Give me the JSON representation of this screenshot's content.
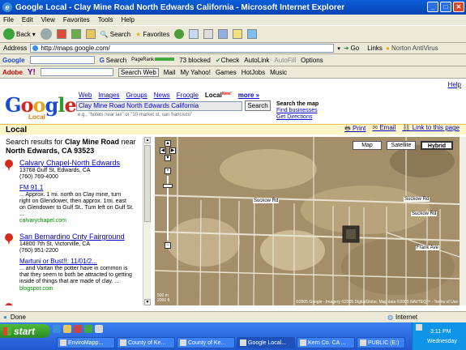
{
  "window": {
    "title": "Google Local - Clay Mine Road North Edwards California - Microsoft Internet Explorer"
  },
  "menu": [
    "File",
    "Edit",
    "View",
    "Favorites",
    "Tools",
    "Help"
  ],
  "toolbar": {
    "back": "Back",
    "search": "Search",
    "favorites": "Favorites"
  },
  "address": {
    "label": "Address",
    "url": "http://maps.google.com/",
    "go": "Go",
    "links": "Links",
    "norton": "Norton AntiVirus"
  },
  "google_toolbar": {
    "label": "Google",
    "search": "Search",
    "pagerank": "PageRank",
    "blocked": "73 blocked",
    "check": "Check",
    "autolink": "AutoLink",
    "autofill": "AutoFill",
    "options": "Options"
  },
  "yahoo_toolbar": {
    "label": "Adobe",
    "yahoo": "Y!",
    "search_web": "Search Web",
    "mail": "Mail",
    "my_yahoo": "My Yahoo!",
    "games": "Games",
    "hotjobs": "HotJobs",
    "music": "Music"
  },
  "page": {
    "help": "Help",
    "logo_sub": "Local",
    "nav": [
      "Web",
      "Images",
      "Groups",
      "News",
      "Froogle"
    ],
    "nav_current": "Local",
    "nav_new": "New!",
    "nav_more": "more »",
    "query": "Clay Mine Road North Edwards California",
    "search_btn": "Search",
    "hint": "e.g., \"hotels near lax\" or \"10 market st, san francisco\"",
    "right_links": {
      "heading": "Search the map",
      "find": "Find businesses",
      "directions": "Get Directions"
    },
    "section": "Local",
    "actions": [
      "Print",
      "Email",
      "Link to this page"
    ]
  },
  "results": {
    "header_prefix": "Search results for ",
    "header_query": "Clay Mine Road",
    "header_near": " near",
    "header_loc": "North Edwards, CA 93523",
    "items": [
      {
        "name": "Calvary Chapel-North Edwards",
        "addr": "13768 Gulf St, Edwards, CA",
        "phone": "(760) 769-4000",
        "sub": "FM 91.1",
        "snip1": "... Approx. 1 mi. north on Clay mine, turn",
        "snip2": "right on Glendower, then approx. 1mi. east",
        "snip3": "on Glendower to Gulf St.. Turn left on Gulf St.",
        "snip4": "...",
        "url": "calvarychapel.com"
      },
      {
        "name": "San Bernardino Cnty Fairground",
        "addr": "14800 7th St, Victorville, CA",
        "phone": "(760) 951-2200",
        "sub": "Martuni or Bust!!: 11/01/2...",
        "snip1": "... and Vartan the potter have in common is",
        "snip2": "that they seem to both be attracted to getting",
        "snip3": "inside of things that are made of clay. ...",
        "url": "blogspot.com"
      }
    ]
  },
  "map": {
    "types": [
      "Map",
      "Satellite",
      "Hybrid"
    ],
    "active_type": "Hybrid",
    "roads": [
      "Suckow Rd",
      "Suckow Rd",
      "Suckow Rd",
      "Frank Ave"
    ],
    "scale": [
      "500 m",
      "2000 ft"
    ],
    "copyright": "©2005 Google - Imagery ©2005 DigitalGlobe, Map data ©2005 NAVTEQ™ - Terms of Use"
  },
  "status": {
    "text": "Done",
    "zone": "Internet"
  },
  "taskbar": {
    "start": "start",
    "tasks": [
      "EnviroMapp...",
      "County of Ke...",
      "County of Ke...",
      "Google Local...",
      "Kern Co. CA ...",
      "PUBLIC (E:)"
    ],
    "time": "3:11 PM",
    "day": "Wednesday"
  }
}
